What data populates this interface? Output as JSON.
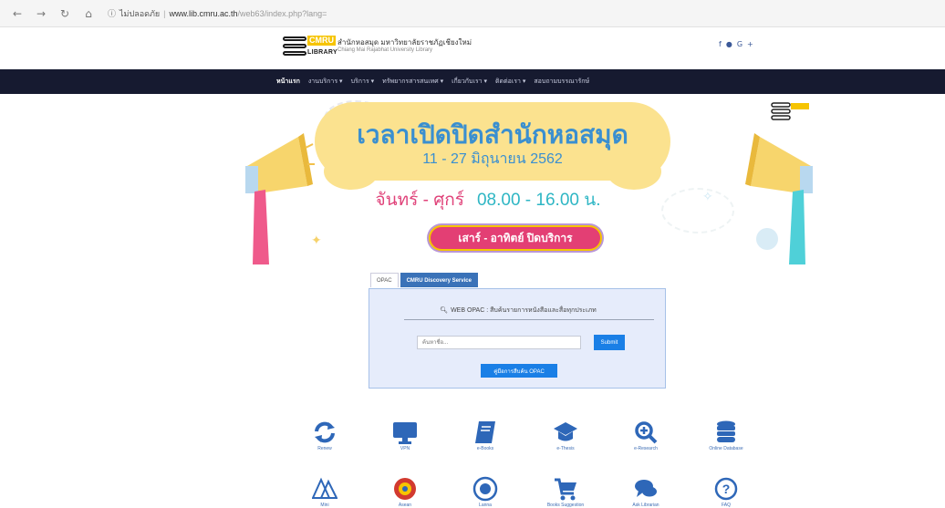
{
  "browser": {
    "nav": {
      "back": "←",
      "forward": "→",
      "reload": "↻",
      "home": "⌂"
    },
    "security_label": "ไม่ปลอดภัย",
    "url_domain": "www.lib.cmru.ac.th",
    "url_path": "/web63/index.php?lang=",
    "icon_names": [
      "back-arrow-icon",
      "forward-arrow-icon",
      "reload-icon",
      "home-icon",
      "info-icon"
    ]
  },
  "header": {
    "logo_cmru": "CMRU",
    "logo_library": "LIBRARY",
    "title_th": "สำนักหอสมุด มหาวิทยาลัยราชภัฏเชียงใหม่",
    "title_en": "Chiang Mai Rajabhat University Library",
    "social": [
      "f",
      "●",
      "G+"
    ]
  },
  "navbar": {
    "items": [
      {
        "label": "หน้าแรก",
        "active": true
      },
      {
        "label": "งานบริการ ▾"
      },
      {
        "label": "บริการ ▾"
      },
      {
        "label": "ทรัพยากรสารสนเทศ ▾"
      },
      {
        "label": "เกี่ยวกับเรา ▾"
      },
      {
        "label": "ติดต่อเรา ▾"
      },
      {
        "label": "สอบถามบรรณารักษ์"
      }
    ]
  },
  "banner": {
    "headline": "เวลาเปิดปิดสำนักหอสมุด",
    "date": "11 - 27 มิถุนายน 2562",
    "days": "จันทร์ - ศุกร์",
    "time": "08.00 - 16.00 น.",
    "closed": "เสาร์ - อาทิตย์  ปิดบริการ",
    "colors": {
      "cloud": "#fbe28f",
      "headline": "#3a8fd0",
      "days": "#e0437a",
      "time": "#2eb6c4",
      "pill": "#e33f74"
    }
  },
  "search": {
    "tabs": [
      {
        "label": "OPAC"
      },
      {
        "label": "CMRU Discovery Service",
        "active": true
      }
    ],
    "title": "WEB OPAC : สืบค้นรายการหนังสือและสื่อทุกประเภท",
    "placeholder": "ค้นหาชื่อ...",
    "submit_label": "Submit",
    "guide_label": "คู่มือการสืบค้น OPAC"
  },
  "icons": {
    "row1": [
      {
        "name": "refresh-icon",
        "label": "Renew",
        "color": "#2e67b8"
      },
      {
        "name": "monitor-icon",
        "label": "VPN",
        "color": "#2e67b8"
      },
      {
        "name": "ebook-icon",
        "label": "e-Books",
        "color": "#2e67b8"
      },
      {
        "name": "graduation-cap-icon",
        "label": "e-Thesis",
        "color": "#2e67b8"
      },
      {
        "name": "zoom-in-icon",
        "label": "e-Research",
        "color": "#2e67b8"
      },
      {
        "name": "database-icon",
        "label": "Online Database",
        "color": "#2e67b8"
      }
    ],
    "row2": [
      {
        "name": "pyramid-icon",
        "label": "Mini",
        "color": "#2e67b8"
      },
      {
        "name": "asean-icon",
        "label": "Asean",
        "color": "#d23a2f"
      },
      {
        "name": "globe-icon",
        "label": "Lanna",
        "color": "#2e67b8"
      },
      {
        "name": "cart-icon",
        "label": "Books Suggestion",
        "color": "#2e67b8"
      },
      {
        "name": "chat-icon",
        "label": "Ask Librarian",
        "color": "#2e67b8"
      },
      {
        "name": "help-icon",
        "label": "FAQ",
        "color": "#2e67b8"
      }
    ]
  }
}
